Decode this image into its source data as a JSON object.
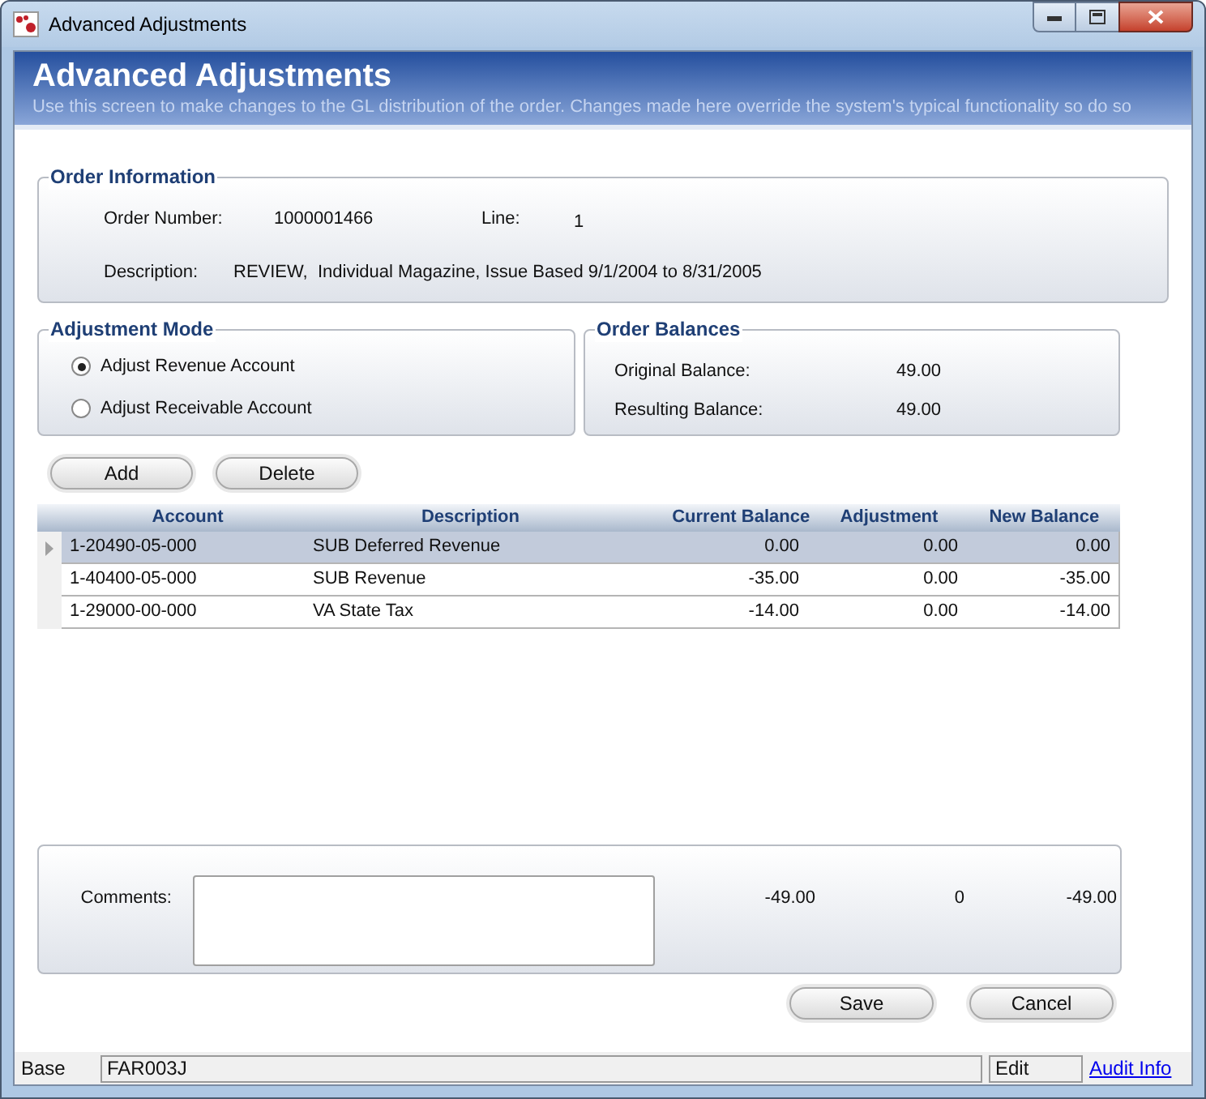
{
  "window": {
    "title": "Advanced Adjustments"
  },
  "header": {
    "title": "Advanced Adjustments",
    "subtitle": "Use this screen to make changes to the GL distribution of the order. Changes made here override the system's typical functionality so do so"
  },
  "order_information": {
    "legend": "Order Information",
    "order_number_label": "Order Number:",
    "order_number": "1000001466",
    "line_label": "Line:",
    "line": "1",
    "description_label": "Description:",
    "description": "REVIEW,  Individual Magazine, Issue Based 9/1/2004 to 8/31/2005"
  },
  "adjustment_mode": {
    "legend": "Adjustment Mode",
    "options": [
      {
        "label": "Adjust Revenue Account",
        "selected": true
      },
      {
        "label": "Adjust Receivable Account",
        "selected": false
      }
    ]
  },
  "order_balances": {
    "legend": "Order Balances",
    "original_label": "Original Balance:",
    "original": "49.00",
    "resulting_label": "Resulting Balance:",
    "resulting": "49.00"
  },
  "grid_buttons": [
    "Add",
    "Delete"
  ],
  "table": {
    "columns": [
      "Account",
      "Description",
      "Current Balance",
      "Adjustment",
      "New Balance"
    ],
    "rows": [
      {
        "selected": true,
        "cells": [
          "1-20490-05-000",
          "SUB Deferred Revenue",
          "0.00",
          "0.00",
          "0.00"
        ]
      },
      {
        "selected": false,
        "cells": [
          "1-40400-05-000",
          "SUB Revenue",
          "-35.00",
          "0.00",
          "-35.00"
        ]
      },
      {
        "selected": false,
        "cells": [
          "1-29000-00-000",
          "VA State Tax",
          "-14.00",
          "0.00",
          "-14.00"
        ]
      }
    ]
  },
  "totals": {
    "comments_label": "Comments:",
    "current_balance": "-49.00",
    "adjustment": "0",
    "new_balance": "-49.00"
  },
  "buttons": [
    "Save",
    "Cancel"
  ],
  "status_bar": {
    "mode": "Base",
    "form": "FAR003J",
    "state": "Edit",
    "link": "Audit Info"
  }
}
